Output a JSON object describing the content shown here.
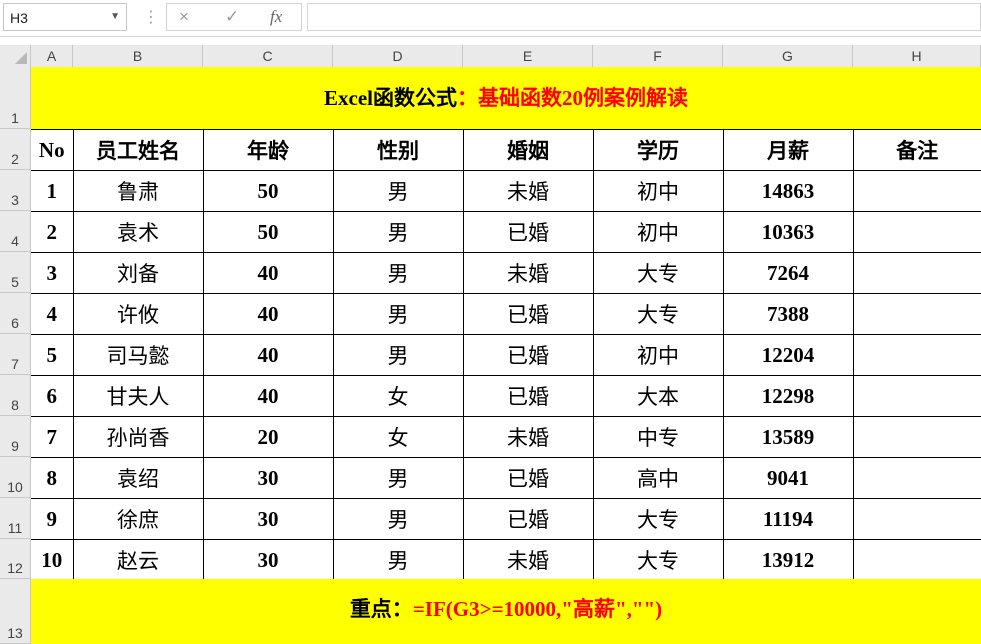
{
  "formula_bar": {
    "name_box": "H3",
    "cancel_icon": "×",
    "enter_icon": "✓",
    "fx_label": "fx",
    "formula": ""
  },
  "columns": [
    "A",
    "B",
    "C",
    "D",
    "E",
    "F",
    "G",
    "H"
  ],
  "rows": [
    "1",
    "2",
    "3",
    "4",
    "5",
    "6",
    "7",
    "8",
    "9",
    "10",
    "11",
    "12",
    "13"
  ],
  "title": {
    "prefix": "Excel函数公式",
    "suffix": "：基础函数20例案例解读",
    "colors": {
      "prefix": "#000000",
      "suffix": "#ff0000"
    }
  },
  "table": {
    "headers": [
      "No",
      "员工姓名",
      "年龄",
      "性别",
      "婚姻",
      "学历",
      "月薪",
      "备注"
    ],
    "records": [
      [
        "1",
        "鲁肃",
        "50",
        "男",
        "未婚",
        "初中",
        "14863",
        ""
      ],
      [
        "2",
        "袁术",
        "50",
        "男",
        "已婚",
        "初中",
        "10363",
        ""
      ],
      [
        "3",
        "刘备",
        "40",
        "男",
        "未婚",
        "大专",
        "7264",
        ""
      ],
      [
        "4",
        "许攸",
        "40",
        "男",
        "已婚",
        "大专",
        "7388",
        ""
      ],
      [
        "5",
        "司马懿",
        "40",
        "男",
        "已婚",
        "初中",
        "12204",
        ""
      ],
      [
        "6",
        "甘夫人",
        "40",
        "女",
        "已婚",
        "大本",
        "12298",
        ""
      ],
      [
        "7",
        "孙尚香",
        "20",
        "女",
        "未婚",
        "中专",
        "13589",
        ""
      ],
      [
        "8",
        "袁绍",
        "30",
        "男",
        "已婚",
        "高中",
        "9041",
        ""
      ],
      [
        "9",
        "徐庶",
        "30",
        "男",
        "已婚",
        "大专",
        "11194",
        ""
      ],
      [
        "10",
        "赵云",
        "30",
        "男",
        "未婚",
        "大专",
        "13912",
        ""
      ]
    ]
  },
  "key_point": {
    "label": "重点：",
    "formula": "=IF(G3>=10000,\"高薪\",\"\")",
    "colors": {
      "label": "#000000",
      "formula": "#ff0000"
    }
  },
  "colors": {
    "highlight": "#ffff00",
    "header_bg": "#eaeaea",
    "grid_border": "#000000"
  }
}
